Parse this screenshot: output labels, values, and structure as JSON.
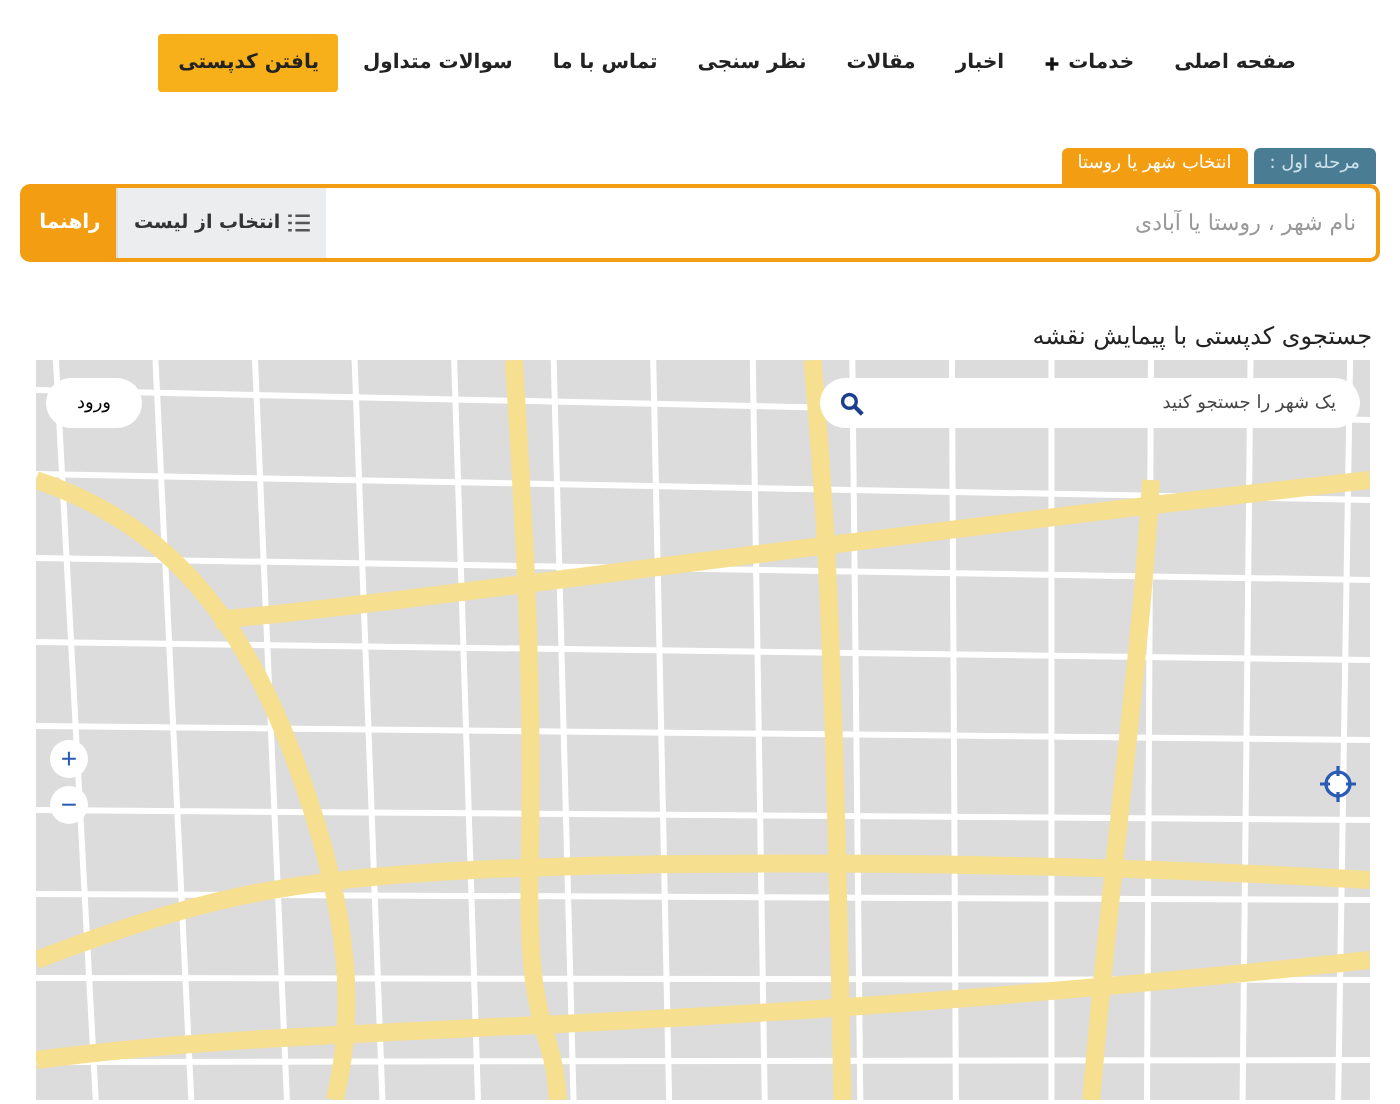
{
  "nav": {
    "items": [
      {
        "label": "صفحه اصلی",
        "has_submenu": false,
        "highlighted": false
      },
      {
        "label": "خدمات",
        "has_submenu": true,
        "highlighted": false
      },
      {
        "label": "اخبار",
        "has_submenu": false,
        "highlighted": false
      },
      {
        "label": "مقالات",
        "has_submenu": false,
        "highlighted": false
      },
      {
        "label": "نظر سنجی",
        "has_submenu": false,
        "highlighted": false
      },
      {
        "label": "تماس با ما",
        "has_submenu": false,
        "highlighted": false
      },
      {
        "label": "سوالات متداول",
        "has_submenu": false,
        "highlighted": false
      },
      {
        "label": "یافتن کدپستی",
        "has_submenu": false,
        "highlighted": true
      }
    ]
  },
  "step_tabs": [
    {
      "label": "مرحله اول :",
      "selected": false
    },
    {
      "label": "انتخاب شهر یا روستا",
      "selected": true
    }
  ],
  "search": {
    "placeholder": "نام شهر ، روستا یا آبادی",
    "list_button": "انتخاب از لیست",
    "help_button": "راهنما"
  },
  "map_section": {
    "heading": "جستجوی کدپستی با پیمایش نقشه",
    "search_placeholder": "یک شهر را جستجو کنید",
    "login_button": "ورود",
    "zoom_in": "+",
    "zoom_out": "−"
  }
}
